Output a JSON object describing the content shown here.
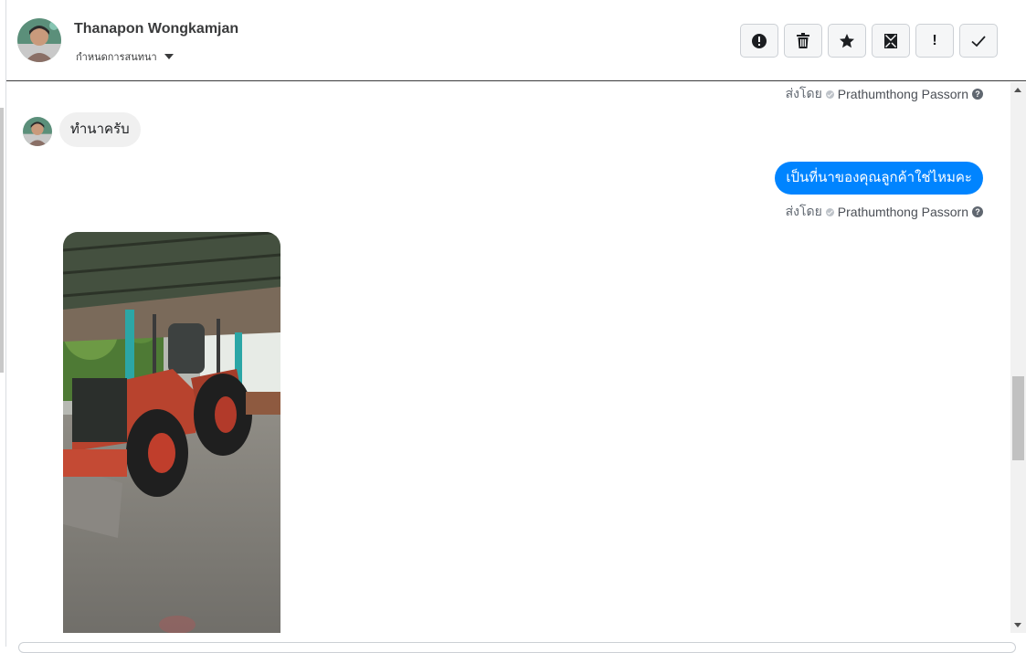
{
  "header": {
    "contact_name": "Thanapon Wongkamjan",
    "assign_label": "กำหนดการสนทนา"
  },
  "toolbar": {
    "buttons": [
      {
        "icon": "spam-alert-icon"
      },
      {
        "icon": "trash-icon"
      },
      {
        "icon": "star-icon"
      },
      {
        "icon": "mark-unread-icon"
      },
      {
        "icon": "exclamation-icon",
        "label": "!"
      },
      {
        "icon": "checkmark-icon"
      }
    ]
  },
  "messages": [
    {
      "type": "meta",
      "sent_by_label": "ส่งโดย",
      "sender": "Prathumthong Passorn",
      "help": "?"
    },
    {
      "type": "incoming",
      "text": "ทำนาครับ"
    },
    {
      "type": "outgoing",
      "text": "เป็นที่นาของคุณลูกค้าใช่ไหมคะ"
    },
    {
      "type": "meta",
      "sent_by_label": "ส่งโดย",
      "sender": "Prathumthong Passorn",
      "help": "?"
    },
    {
      "type": "incoming-image",
      "subject": "tractor-photo"
    }
  ],
  "colors": {
    "outgoing_bubble": "#0084ff",
    "incoming_bubble": "#f0f0f0"
  }
}
